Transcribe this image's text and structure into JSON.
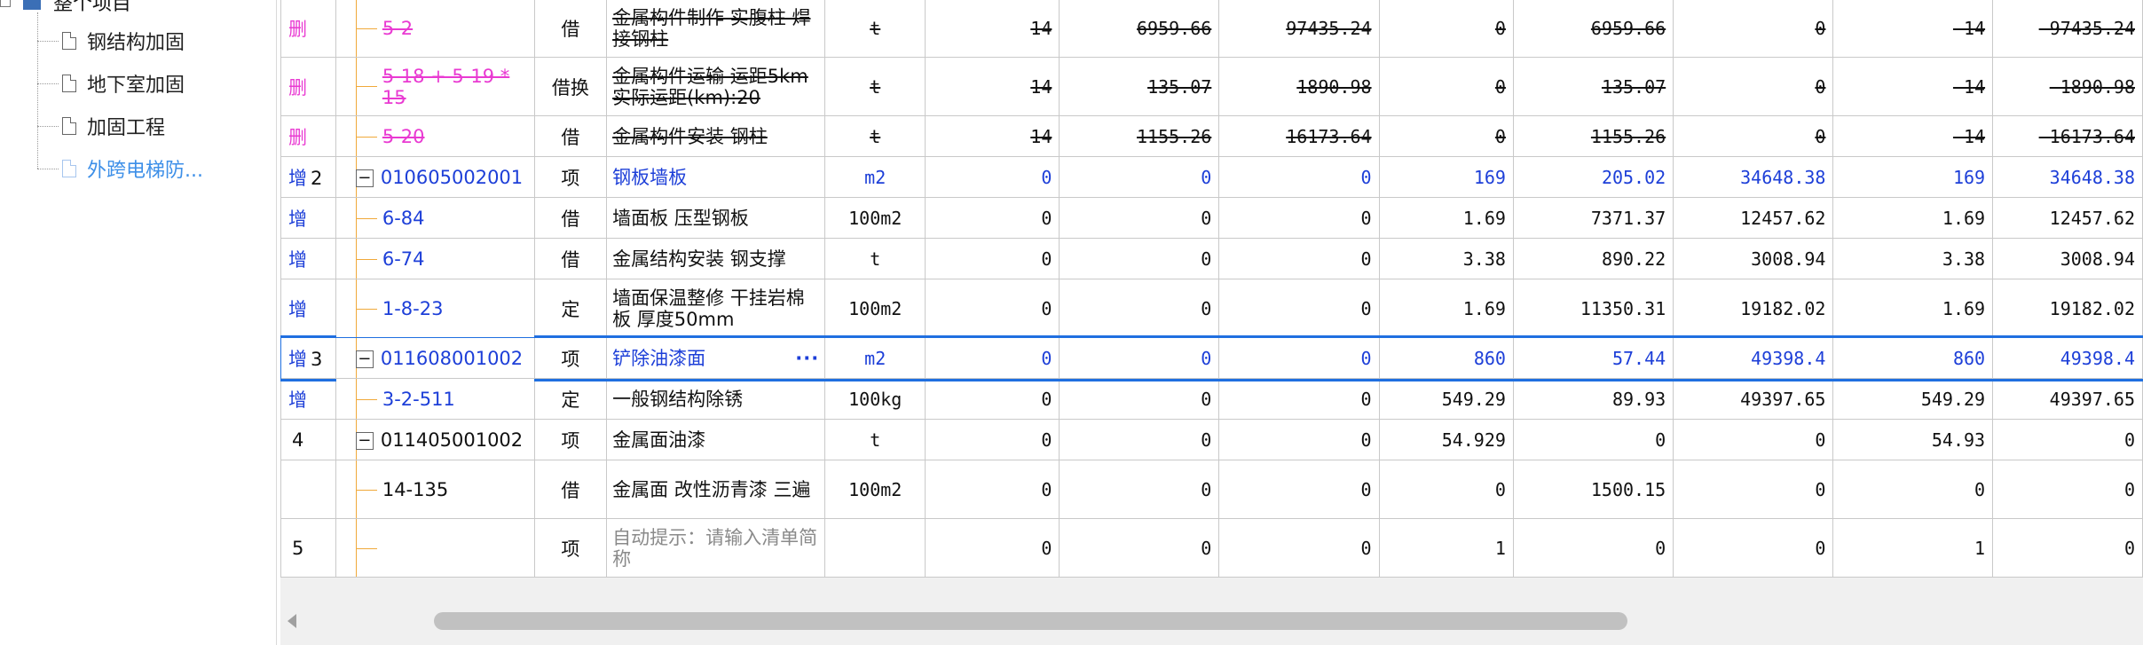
{
  "sidebar": {
    "root_label": "整个项目",
    "items": [
      {
        "label": "钢结构加固"
      },
      {
        "label": "地下室加固"
      },
      {
        "label": "加固工程"
      },
      {
        "label": "外跨电梯防..."
      }
    ]
  },
  "rows": [
    {
      "op": "删",
      "seq": "",
      "code": "5-2",
      "type": "借",
      "name": "金属构件制作 实腹柱 焊接钢柱",
      "unit": "t",
      "c1": "14",
      "c2": "6959.66",
      "c3": "97435.24",
      "c4": "0",
      "c5": "6959.66",
      "c6": "0",
      "c7": "-14",
      "c8": "-97435.24"
    },
    {
      "op": "删",
      "seq": "",
      "code": "5-18 + 5-19 * 15",
      "type": "借换",
      "name": "金属构件运输 运距5km 实际运距(km):20",
      "unit": "t",
      "c1": "14",
      "c2": "135.07",
      "c3": "1890.98",
      "c4": "0",
      "c5": "135.07",
      "c6": "0",
      "c7": "-14",
      "c8": "-1890.98"
    },
    {
      "op": "删",
      "seq": "",
      "code": "5-20",
      "type": "借",
      "name": "金属构件安装 钢柱",
      "unit": "t",
      "c1": "14",
      "c2": "1155.26",
      "c3": "16173.64",
      "c4": "0",
      "c5": "1155.26",
      "c6": "0",
      "c7": "-14",
      "c8": "-16173.64"
    },
    {
      "op": "增",
      "seq": "2",
      "code": "010605002001",
      "type": "项",
      "name": "钢板墙板",
      "unit": "m2",
      "c1": "0",
      "c2": "0",
      "c3": "0",
      "c4": "169",
      "c5": "205.02",
      "c6": "34648.38",
      "c7": "169",
      "c8": "34648.38"
    },
    {
      "op": "增",
      "seq": "",
      "code": "6-84",
      "type": "借",
      "name": "墙面板 压型钢板",
      "unit": "100m2",
      "c1": "0",
      "c2": "0",
      "c3": "0",
      "c4": "1.69",
      "c5": "7371.37",
      "c6": "12457.62",
      "c7": "1.69",
      "c8": "12457.62"
    },
    {
      "op": "增",
      "seq": "",
      "code": "6-74",
      "type": "借",
      "name": "金属结构安装 钢支撑",
      "unit": "t",
      "c1": "0",
      "c2": "0",
      "c3": "0",
      "c4": "3.38",
      "c5": "890.22",
      "c6": "3008.94",
      "c7": "3.38",
      "c8": "3008.94"
    },
    {
      "op": "增",
      "seq": "",
      "code": "1-8-23",
      "type": "定",
      "name": "墙面保温整修 干挂岩棉板 厚度50mm",
      "unit": "100m2",
      "c1": "0",
      "c2": "0",
      "c3": "0",
      "c4": "1.69",
      "c5": "11350.31",
      "c6": "19182.02",
      "c7": "1.69",
      "c8": "19182.02"
    },
    {
      "op": "增",
      "seq": "3",
      "code": "011608001002",
      "type": "项",
      "name": "铲除油漆面",
      "unit": "m2",
      "c1": "0",
      "c2": "0",
      "c3": "0",
      "c4": "860",
      "c5": "57.44",
      "c6": "49398.4",
      "c7": "860",
      "c8": "49398.4"
    },
    {
      "op": "增",
      "seq": "",
      "code": "3-2-511",
      "type": "定",
      "name": "一般钢结构除锈",
      "unit": "100kg",
      "c1": "0",
      "c2": "0",
      "c3": "0",
      "c4": "549.29",
      "c5": "89.93",
      "c6": "49397.65",
      "c7": "549.29",
      "c8": "49397.65"
    },
    {
      "op": "",
      "seq": "4",
      "code": "011405001002",
      "type": "项",
      "name": "金属面油漆",
      "unit": "t",
      "c1": "0",
      "c2": "0",
      "c3": "0",
      "c4": "54.929",
      "c5": "0",
      "c6": "0",
      "c7": "54.93",
      "c8": "0"
    },
    {
      "op": "",
      "seq": "",
      "code": "14-135",
      "type": "借",
      "name": "金属面 改性沥青漆 三遍",
      "unit": "100m2",
      "c1": "0",
      "c2": "0",
      "c3": "0",
      "c4": "0",
      "c5": "1500.15",
      "c6": "0",
      "c7": "0",
      "c8": "0"
    },
    {
      "op": "",
      "seq": "5",
      "code": "",
      "type": "项",
      "name": "自动提示：请输入清单简称",
      "unit": "",
      "c1": "0",
      "c2": "0",
      "c3": "0",
      "c4": "1",
      "c5": "0",
      "c6": "0",
      "c7": "1",
      "c8": "0"
    }
  ],
  "expander_symbol": "−",
  "ellipsis": "···"
}
